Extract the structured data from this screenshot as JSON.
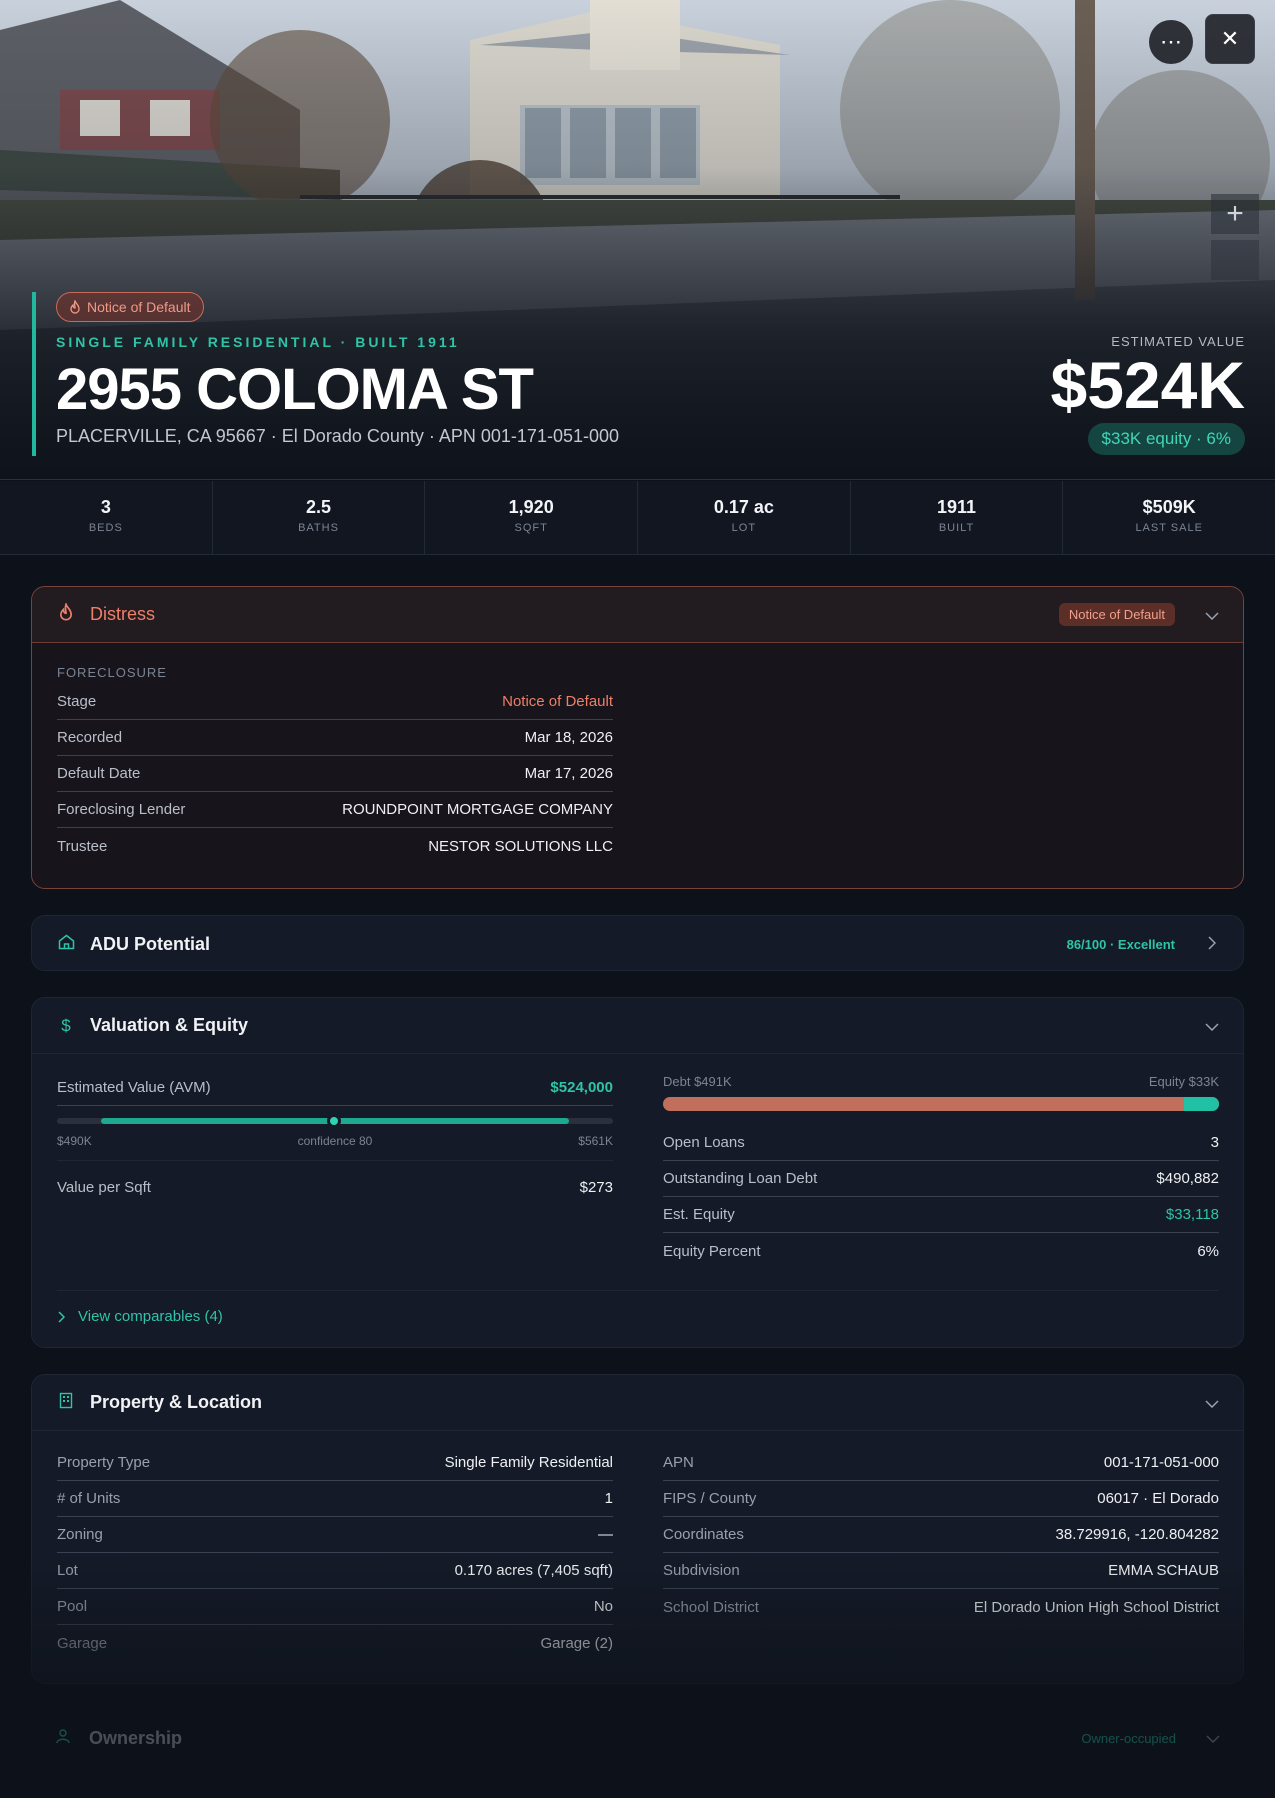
{
  "hero": {
    "status_pill": "Notice of Default",
    "subtitle": "SINGLE FAMILY RESIDENTIAL · BUILT 1911",
    "address": "2955 COLOMA ST",
    "location": "PLACERVILLE, CA 95667 · El Dorado County · APN 001-171-051-000",
    "est_label": "ESTIMATED VALUE",
    "est_value": "$524K",
    "equity_pill": "$33K equity · 6%",
    "more_icon": "⋯",
    "close_icon": "✕",
    "zoom_in_icon": "+"
  },
  "stats": [
    {
      "value": "3",
      "label": "BEDS"
    },
    {
      "value": "2.5",
      "label": "BATHS"
    },
    {
      "value": "1,920",
      "label": "SQFT"
    },
    {
      "value": "0.17 ac",
      "label": "LOT"
    },
    {
      "value": "1911",
      "label": "BUILT"
    },
    {
      "value": "$509K",
      "label": "LAST SALE"
    }
  ],
  "distress": {
    "title": "Distress",
    "badge": "Notice of Default",
    "section": "FORECLOSURE",
    "rows": [
      {
        "k": "Stage",
        "v": "Notice of Default"
      },
      {
        "k": "Recorded",
        "v": "Mar 18, 2026"
      },
      {
        "k": "Default Date",
        "v": "Mar 17, 2026"
      },
      {
        "k": "Foreclosing Lender",
        "v": "ROUNDPOINT MORTGAGE COMPANY"
      },
      {
        "k": "Trustee",
        "v": "NESTOR SOLUTIONS LLC"
      }
    ]
  },
  "adu": {
    "title": "ADU Potential",
    "score": "86/100 · Excellent"
  },
  "valuation": {
    "title": "Valuation & Equity",
    "avm_label": "Estimated Value (AVM)",
    "avm_value": "$524,000",
    "avm_low": "$490K",
    "avm_mid": "confidence 80",
    "avm_high": "$561K",
    "ppsf_label": "Value per Sqft",
    "ppsf_value": "$273",
    "debt_label": "Debt $491K",
    "equity_label": "Equity $33K",
    "equity_fraction": 0.063,
    "rows": [
      {
        "k": "Open Loans",
        "v": "3"
      },
      {
        "k": "Outstanding Loan Debt",
        "v": "$490,882"
      },
      {
        "k": "Est. Equity",
        "v": "$33,118"
      },
      {
        "k": "Equity Percent",
        "v": "6%"
      }
    ],
    "comps_link": "View comparables (4)"
  },
  "property": {
    "title": "Property & Location",
    "left": [
      {
        "k": "Property Type",
        "v": "Single Family Residential"
      },
      {
        "k": "# of Units",
        "v": "1"
      },
      {
        "k": "Zoning",
        "v": "—"
      },
      {
        "k": "Lot",
        "v": "0.170 acres (7,405 sqft)"
      },
      {
        "k": "Pool",
        "v": "No"
      },
      {
        "k": "Garage",
        "v": "Garage (2)"
      }
    ],
    "right": [
      {
        "k": "APN",
        "v": "001-171-051-000"
      },
      {
        "k": "FIPS / County",
        "v": "06017 · El Dorado"
      },
      {
        "k": "Coordinates",
        "v": "38.729916, -120.804282"
      },
      {
        "k": "Subdivision",
        "v": "EMMA SCHAUB"
      },
      {
        "k": "School District",
        "v": "El Dorado Union High School District"
      }
    ]
  },
  "ownership": {
    "title": "Ownership",
    "tag": "Owner-occupied"
  },
  "colors": {
    "accent": "#2fc3a8",
    "distress": "#ef7f68",
    "debt": "#c26e5c",
    "background": "#0d1119"
  }
}
